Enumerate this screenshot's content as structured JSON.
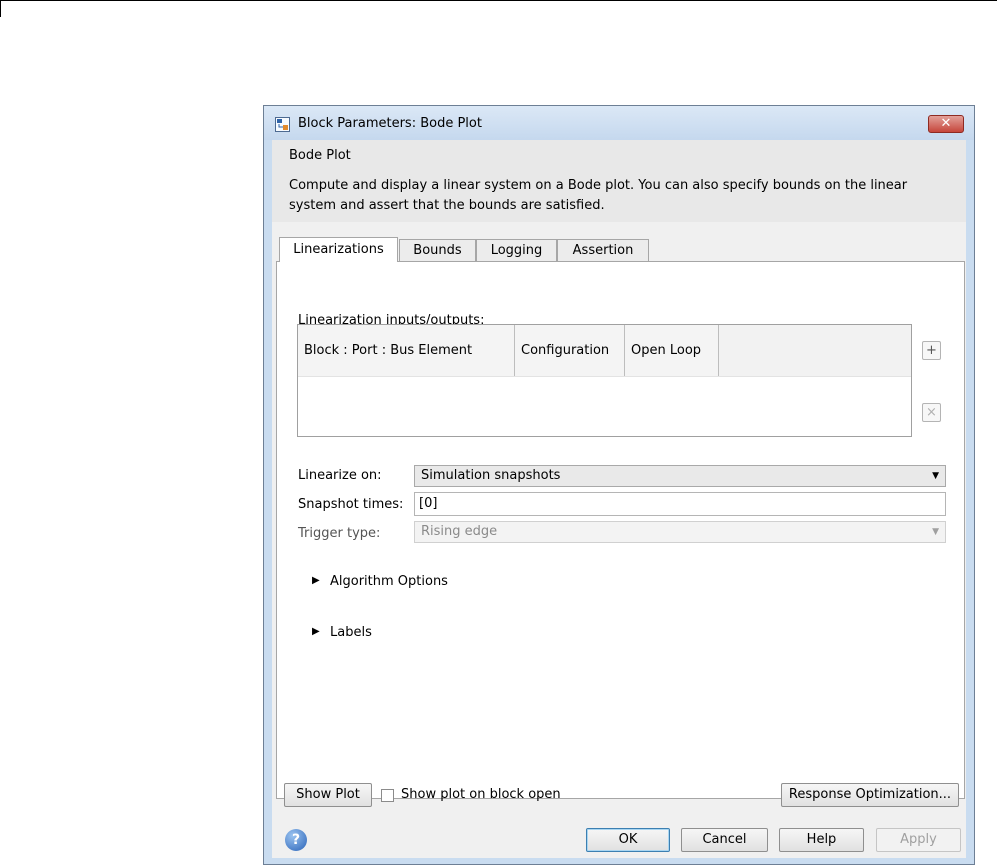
{
  "window": {
    "title": "Block Parameters: Bode Plot",
    "close_symbol": "✕",
    "icon": "simulink-block-icon"
  },
  "header": {
    "group_title": "Bode Plot",
    "description": "Compute and display a linear system on a Bode plot. You can also specify bounds on the linear system and assert that the bounds are satisfied."
  },
  "tabs": [
    {
      "label": "Linearizations",
      "active": true
    },
    {
      "label": "Bounds",
      "active": false
    },
    {
      "label": "Logging",
      "active": false
    },
    {
      "label": "Assertion",
      "active": false
    }
  ],
  "linearizations": {
    "io_label": "Linearization inputs/outputs:",
    "table_columns": [
      "Block : Port : Bus Element",
      "Configuration",
      "Open Loop"
    ],
    "add_symbol": "+",
    "remove_symbol": "×",
    "linearize_on_label": "Linearize on:",
    "linearize_on_value": "Simulation snapshots",
    "snapshot_times_label": "Snapshot times:",
    "snapshot_times_value": "[0]",
    "trigger_type_label": "Trigger type:",
    "trigger_type_value": "Rising edge",
    "algorithm_options_label": "Algorithm Options",
    "labels_label": "Labels"
  },
  "footer": {
    "show_plot_label": "Show Plot",
    "show_plot_on_open_label": "Show plot on block open",
    "show_plot_on_open_checked": false,
    "response_optimization_label": "Response Optimization...",
    "ok_label": "OK",
    "cancel_label": "Cancel",
    "help_label": "Help",
    "apply_label": "Apply",
    "help_icon_symbol": "?"
  }
}
